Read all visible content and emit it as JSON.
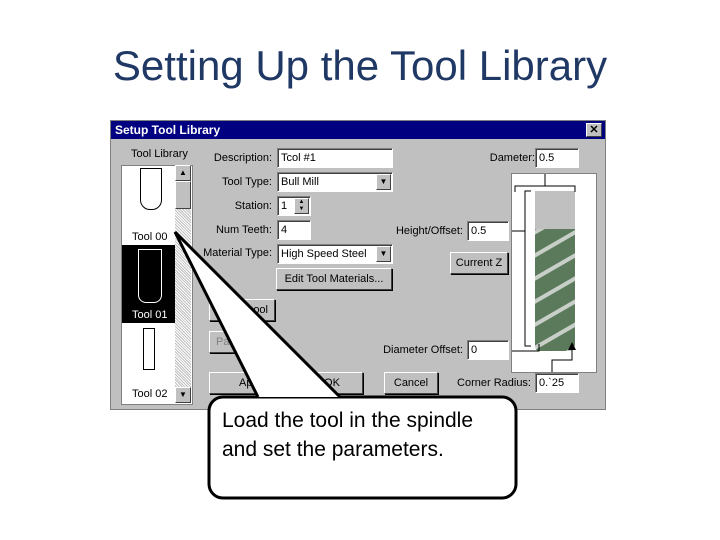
{
  "slide": {
    "title": "Setting Up the Tool Library",
    "callout": "Load the tool in the spindle and set the parameters."
  },
  "dialog": {
    "title": "Setup Tool Library",
    "close_icon": "close-icon",
    "library_label": "Tool Library",
    "tools": [
      "Tool 00",
      "Tool 01",
      "Tool 02"
    ],
    "selected_tool": "Tool 01",
    "description_label": "Description:",
    "description": "Tcol #1",
    "tool_type_label": "Tool Type:",
    "tool_type": "Bull Mill",
    "station_label": "Station:",
    "station": "1",
    "num_teeth_label": "Num Teeth:",
    "num_teeth": "4",
    "material_label": "Material Type:",
    "material": "High Speed Steel",
    "edit_materials": "Edit Tool Materials...",
    "load_tool": "ool",
    "param": "Pa",
    "apply": "Appl",
    "ok": "OK",
    "cancel": "Cancel",
    "diameter_label": "Dameter:",
    "diameter": "0.5",
    "height_label": "Height/Offset:",
    "height": "0.5",
    "current_z": "Current Z",
    "diam_offset_label": "Diameter Offset:",
    "diam_offset": "0",
    "corner_label": "Corner Radius:",
    "corner": "0.`25"
  }
}
